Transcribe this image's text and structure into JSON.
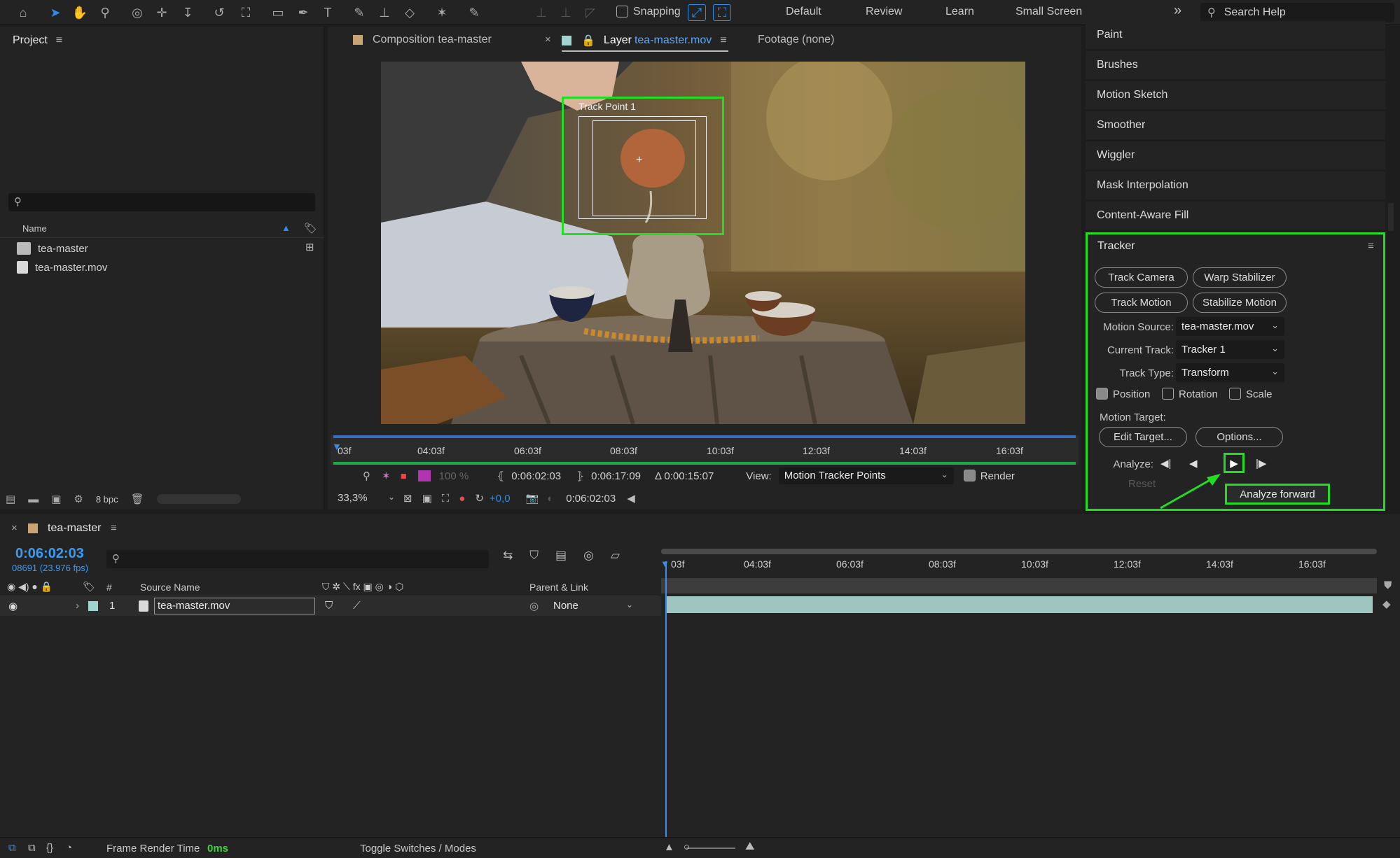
{
  "toolbar": {
    "snapping_label": "Snapping",
    "workspaces": [
      "Default",
      "Review",
      "Learn",
      "Small Screen"
    ],
    "more_label": "»",
    "search_placeholder": "Search Help"
  },
  "project": {
    "title": "Project",
    "column_name": "Name",
    "items": [
      {
        "name": "tea-master",
        "icon": "composition-icon"
      },
      {
        "name": "tea-master.mov",
        "icon": "footage-icon"
      }
    ],
    "bpc": "8 bpc"
  },
  "viewer": {
    "tabs": [
      {
        "label": "Composition tea-master",
        "color": "#c8a373"
      },
      {
        "prefix": "Layer",
        "label": "tea-master.mov",
        "color": "#9fd4d0"
      },
      {
        "label": "Footage (none)"
      }
    ],
    "track_point_label": "Track Point 1",
    "ruler_ticks": [
      "03f",
      "04:03f",
      "06:03f",
      "08:03f",
      "10:03f",
      "12:03f",
      "14:03f",
      "16:03f"
    ],
    "zoom_pct": "100 %",
    "in_time": "0:06:02:03",
    "out_time": "0:06:17:09",
    "duration": "Δ 0:00:15:07",
    "view_label": "View:",
    "view_value": "Motion Tracker Points",
    "render_label": "Render",
    "magnification": "33,3%",
    "exposure": "+0,0",
    "current_time": "0:06:02:03"
  },
  "effects": {
    "items": [
      "Paint",
      "Brushes",
      "Motion Sketch",
      "Smoother",
      "Wiggler",
      "Mask Interpolation",
      "Content-Aware Fill"
    ]
  },
  "tracker": {
    "title": "Tracker",
    "buttons": [
      "Track Camera",
      "Warp Stabilizer",
      "Track Motion",
      "Stabilize Motion"
    ],
    "motion_source_label": "Motion Source:",
    "motion_source_value": "tea-master.mov",
    "current_track_label": "Current Track:",
    "current_track_value": "Tracker 1",
    "track_type_label": "Track Type:",
    "track_type_value": "Transform",
    "position_label": "Position",
    "rotation_label": "Rotation",
    "scale_label": "Scale",
    "position_checked": true,
    "rotation_checked": false,
    "scale_checked": false,
    "motion_target_label": "Motion Target:",
    "edit_target_label": "Edit Target...",
    "options_label": "Options...",
    "analyze_label": "Analyze:",
    "reset_label": "Reset",
    "tooltip": "Analyze forward",
    "highlight_color": "#22dd22"
  },
  "timeline": {
    "comp_name": "tea-master",
    "timecode": "0:06:02:03",
    "frame_info": "08691 (23.976 fps)",
    "ruler_ticks": [
      "03f",
      "04:03f",
      "06:03f",
      "08:03f",
      "10:03f",
      "12:03f",
      "14:03f",
      "16:03f"
    ],
    "col_number": "#",
    "col_source": "Source Name",
    "col_parent": "Parent & Link",
    "layer": {
      "index": "1",
      "name": "tea-master.mov",
      "parent": "None"
    }
  },
  "status": {
    "frame_render_label": "Frame Render Time",
    "frame_render_value": "0ms",
    "toggle_label": "Toggle Switches / Modes"
  }
}
